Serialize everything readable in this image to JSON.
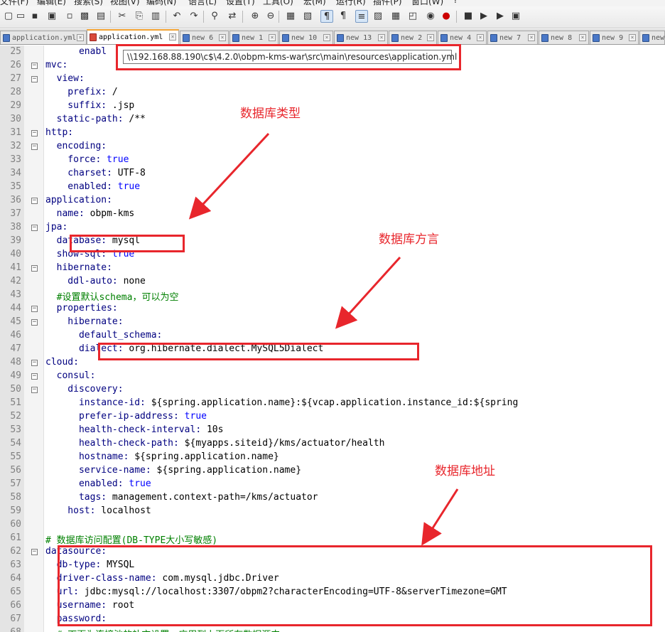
{
  "menu": [
    "文件(F)",
    "编辑(E)",
    "搜索(S)",
    "视图(V)",
    "编码(N)",
    "语言(L)",
    "设置(T)",
    "工具(O)",
    "宏(M)",
    "运行(R)",
    "插件(P)",
    "窗口(W)",
    "?"
  ],
  "toolbar": [
    "new-file-icon",
    "open-file-icon",
    "save-icon",
    "save-all-icon",
    "close-icon",
    "close-all-icon",
    "print-icon",
    "cut-icon",
    "copy-icon",
    "paste-icon",
    "undo-icon",
    "redo-icon",
    "find-icon",
    "replace-icon",
    "zoom-in-icon",
    "zoom-out-icon",
    "sync-v-icon",
    "sync-h-icon",
    "word-wrap-icon",
    "show-all-chars-icon",
    "indent-guide-icon",
    "doc-map-icon",
    "function-list-icon",
    "folder-workspace-icon",
    "monitor-icon",
    "record-macro-icon",
    "stop-macro-icon",
    "play-macro-icon",
    "run-macro-multiple-icon",
    "save-macro-icon"
  ],
  "tabs": [
    {
      "label": "application.yml",
      "active": false
    },
    {
      "label": "application.yml",
      "active": true
    },
    {
      "label": "new 6",
      "active": false
    },
    {
      "label": "new 1",
      "active": false
    },
    {
      "label": "new 10",
      "active": false
    },
    {
      "label": "new 13",
      "active": false
    },
    {
      "label": "new 2",
      "active": false
    },
    {
      "label": "new 4",
      "active": false
    },
    {
      "label": "new 7",
      "active": false
    },
    {
      "label": "new 8",
      "active": false
    },
    {
      "label": "new 9",
      "active": false
    },
    {
      "label": "new",
      "active": false
    }
  ],
  "tooltip": "\\\\192.168.88.190\\c$\\4.2.0\\obpm-kms-war\\src\\main\\resources\\application.yml",
  "lines": [
    {
      "n": "25",
      "key": "      enabl",
      "val": ""
    },
    {
      "n": "26",
      "key": "mvc:",
      "val": ""
    },
    {
      "n": "27",
      "key": "  view:",
      "val": ""
    },
    {
      "n": "28",
      "key": "    prefix:",
      "val": " /"
    },
    {
      "n": "29",
      "key": "    suffix:",
      "val": " .jsp"
    },
    {
      "n": "30",
      "key": "  static-path:",
      "val": " /**"
    },
    {
      "n": "31",
      "key": "http:",
      "val": ""
    },
    {
      "n": "32",
      "key": "  encoding:",
      "val": ""
    },
    {
      "n": "33",
      "key": "    force:",
      "val": " true"
    },
    {
      "n": "34",
      "key": "    charset:",
      "val": " UTF-8"
    },
    {
      "n": "35",
      "key": "    enabled:",
      "val": " true"
    },
    {
      "n": "36",
      "key": "application:",
      "val": ""
    },
    {
      "n": "37",
      "key": "  name:",
      "val": " obpm-kms"
    },
    {
      "n": "38",
      "key": "jpa:",
      "val": ""
    },
    {
      "n": "39",
      "key": "  database:",
      "val": " mysql"
    },
    {
      "n": "40",
      "key": "  show-sql:",
      "val": " true"
    },
    {
      "n": "41",
      "key": "  hibernate:",
      "val": ""
    },
    {
      "n": "42",
      "key": "    ddl-auto:",
      "val": " none"
    },
    {
      "n": "43",
      "comment": "  #设置默认schema，可以为空"
    },
    {
      "n": "44",
      "key": "  properties:",
      "val": ""
    },
    {
      "n": "45",
      "key": "    hibernate:",
      "val": ""
    },
    {
      "n": "46",
      "key": "      default_schema:",
      "val": ""
    },
    {
      "n": "47",
      "key": "      dialect:",
      "val": " org.hibernate.dialect.MySQL5Dialect"
    },
    {
      "n": "48",
      "key": "cloud:",
      "val": ""
    },
    {
      "n": "49",
      "key": "  consul:",
      "val": ""
    },
    {
      "n": "50",
      "key": "    discovery:",
      "val": ""
    },
    {
      "n": "51",
      "key": "      instance-id:",
      "val": " ${spring.application.name}:${vcap.application.instance_id:${spring"
    },
    {
      "n": "52",
      "key": "      prefer-ip-address:",
      "val": " true"
    },
    {
      "n": "53",
      "key": "      health-check-interval:",
      "val": " 10s"
    },
    {
      "n": "54",
      "key": "      health-check-path:",
      "val": " ${myapps.siteid}/kms/actuator/health"
    },
    {
      "n": "55",
      "key": "      hostname:",
      "val": " ${spring.application.name}"
    },
    {
      "n": "56",
      "key": "      service-name:",
      "val": " ${spring.application.name}"
    },
    {
      "n": "57",
      "key": "      enabled:",
      "val": " true"
    },
    {
      "n": "58",
      "key": "      tags:",
      "val": " management.context-path=/kms/actuator"
    },
    {
      "n": "59",
      "key": "    host:",
      "val": " localhost"
    },
    {
      "n": "60",
      "key": "",
      "val": ""
    },
    {
      "n": "61",
      "comment": "# 数据库访问配置(DB-TYPE大小写敏感)"
    },
    {
      "n": "62",
      "key": "datasource:",
      "val": ""
    },
    {
      "n": "63",
      "key": "  db-type:",
      "val": " MYSQL"
    },
    {
      "n": "64",
      "key": "  driver-class-name:",
      "val": " com.mysql.jdbc.Driver"
    },
    {
      "n": "65",
      "key": "  url:",
      "val": " jdbc:mysql://localhost:3307/obpm2?characterEncoding=UTF-8&serverTimezone=GMT"
    },
    {
      "n": "66",
      "key": "  username:",
      "val": " root"
    },
    {
      "n": "67",
      "key": "  password:",
      "val": ""
    },
    {
      "n": "68",
      "comment": "  # 下面为连接池的补充设置，应用到上面所有数据源中"
    }
  ],
  "annotations": {
    "db_type": "数据库类型",
    "dialect": "数据库方言",
    "address": "数据库地址"
  },
  "colors": {
    "annotation": "#e8262c",
    "keyword": "#000080",
    "comment": "#008000",
    "active_tab": "#f0a030"
  }
}
